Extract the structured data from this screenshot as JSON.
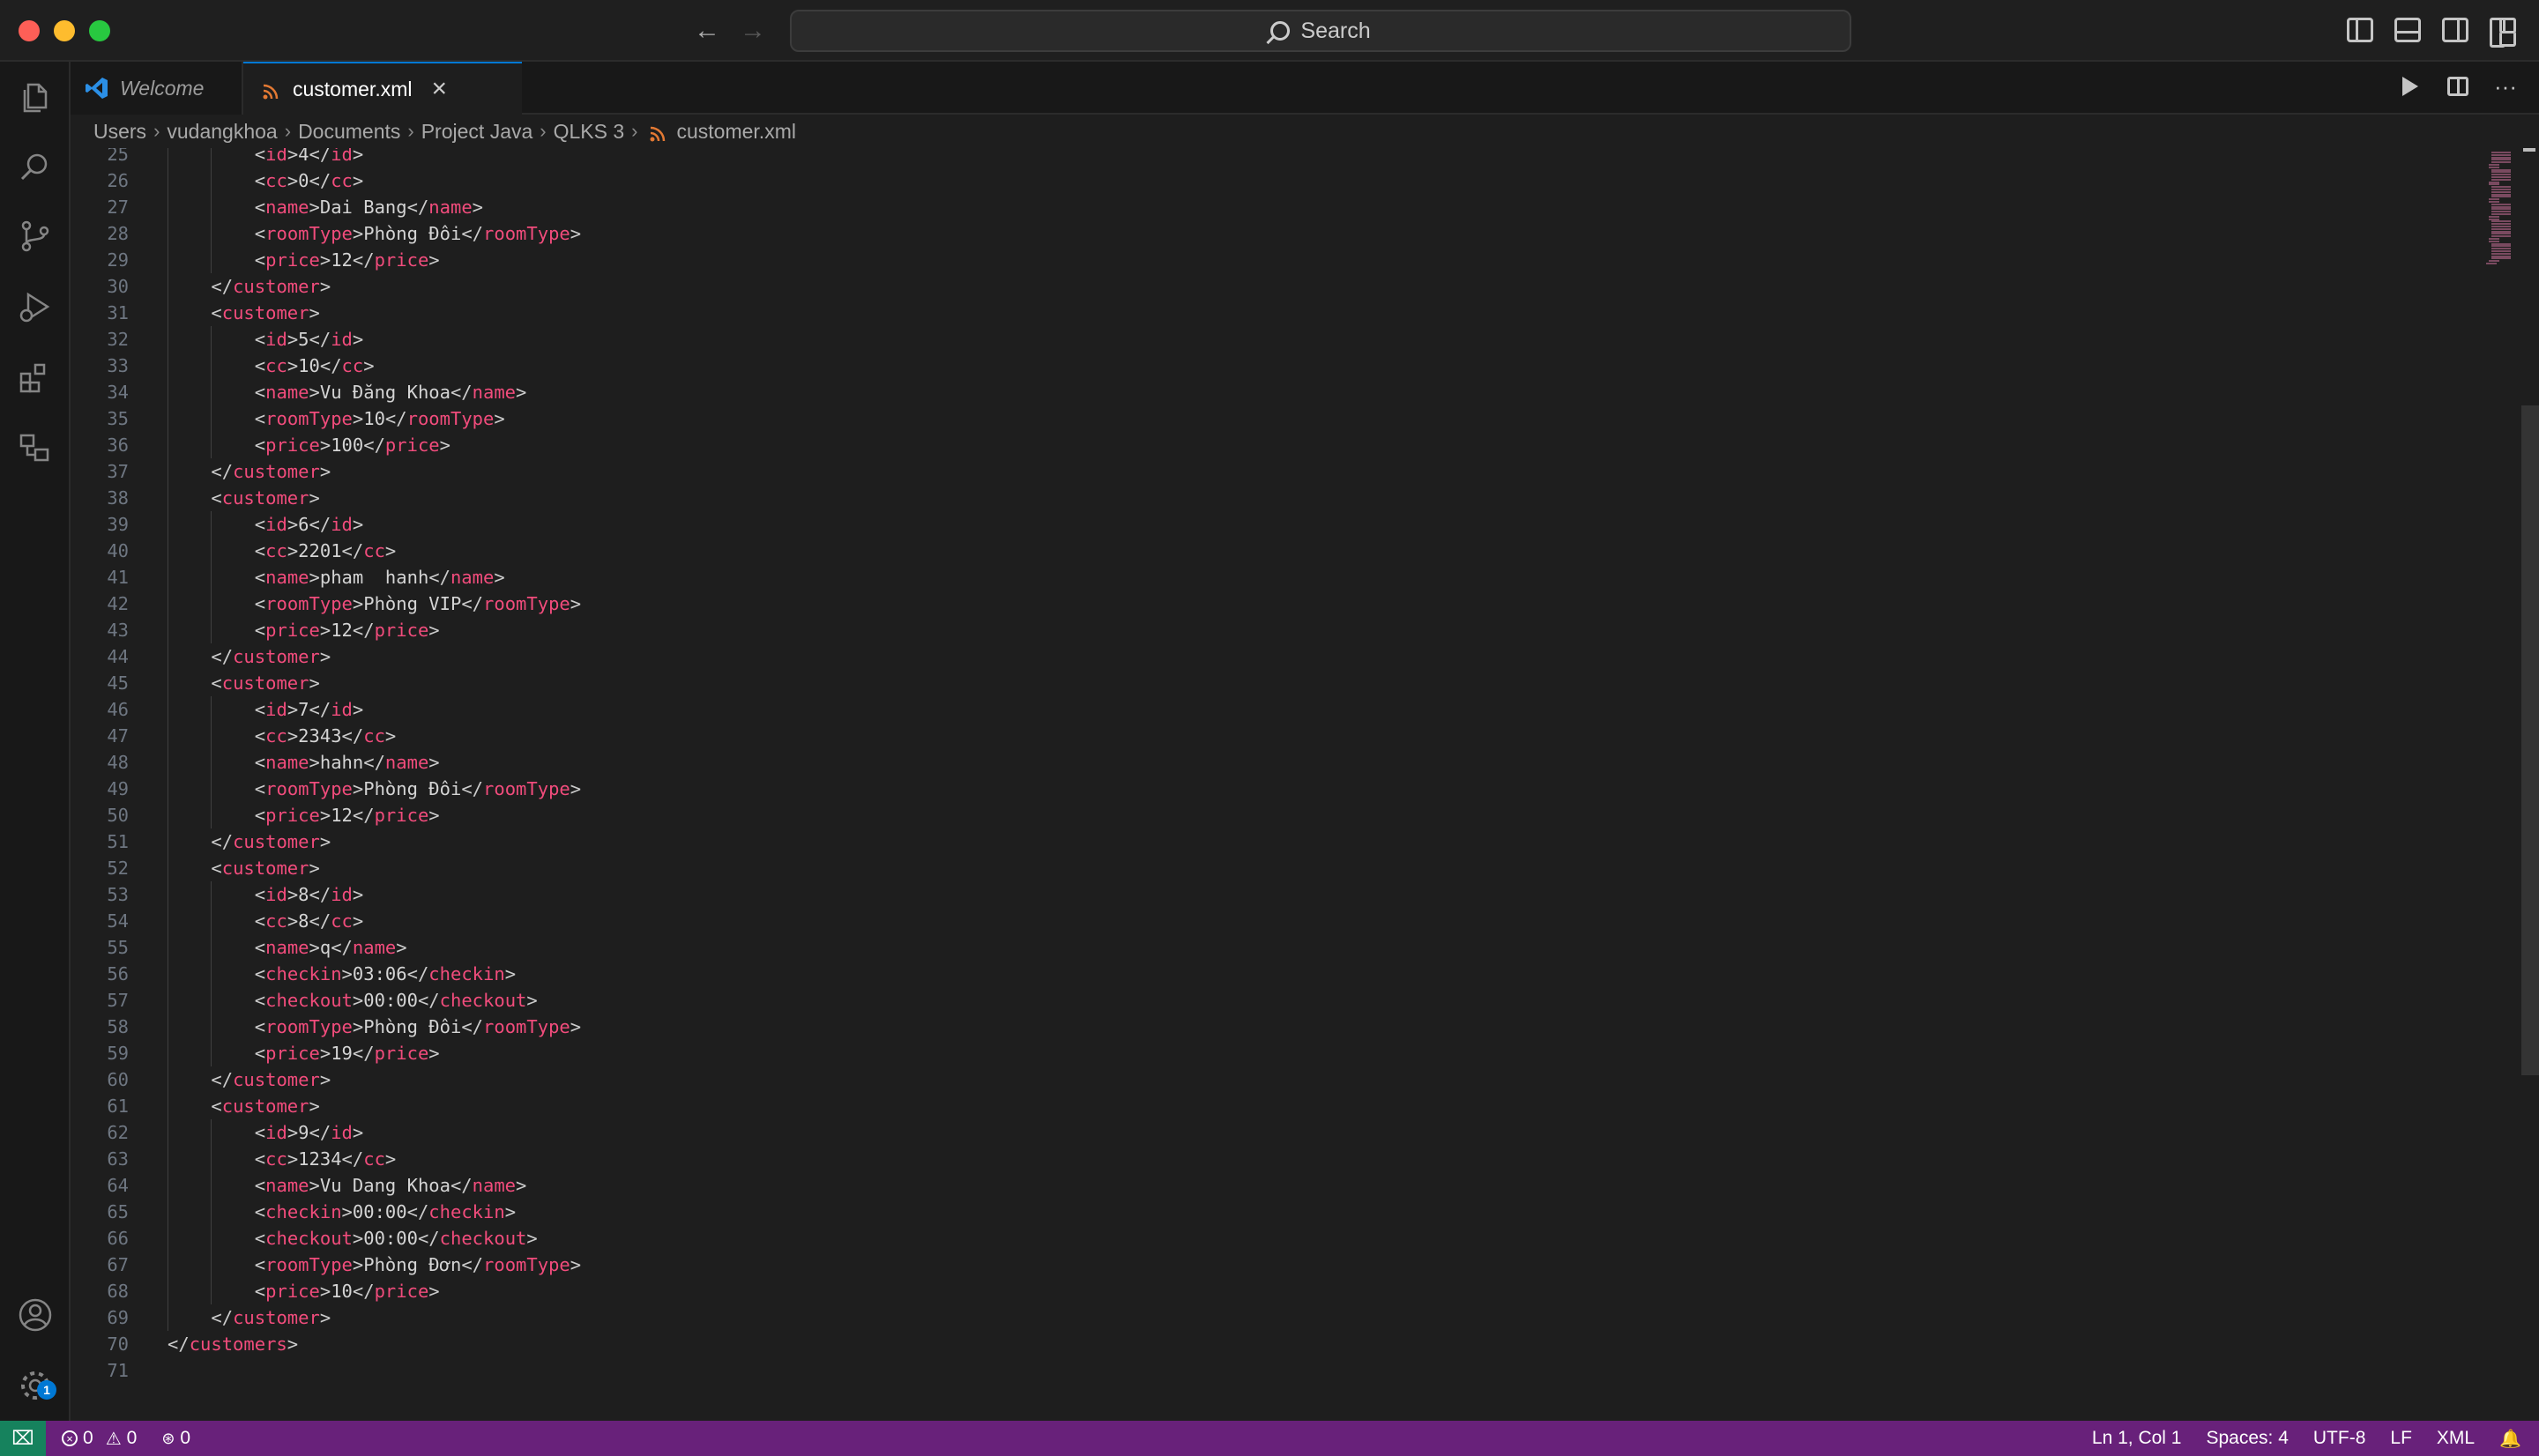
{
  "titlebar": {
    "search_label": "Search"
  },
  "tabs": [
    {
      "label": "Welcome"
    },
    {
      "label": "customer.xml"
    }
  ],
  "breadcrumb": [
    "Users",
    "vudangkhoa",
    "Documents",
    "Project Java",
    "QLKS 3",
    "customer.xml"
  ],
  "editor": {
    "lines": [
      {
        "n": "25",
        "indent": 2,
        "tag": "id",
        "value": "4"
      },
      {
        "n": "26",
        "indent": 2,
        "tag": "cc",
        "value": "0"
      },
      {
        "n": "27",
        "indent": 2,
        "tag": "name",
        "value": "Dai Bang"
      },
      {
        "n": "28",
        "indent": 2,
        "tag": "roomType",
        "value": "Phòng Đôi"
      },
      {
        "n": "29",
        "indent": 2,
        "tag": "price",
        "value": "12"
      },
      {
        "n": "30",
        "indent": 1,
        "close": "customer"
      },
      {
        "n": "31",
        "indent": 1,
        "open": "customer"
      },
      {
        "n": "32",
        "indent": 2,
        "tag": "id",
        "value": "5"
      },
      {
        "n": "33",
        "indent": 2,
        "tag": "cc",
        "value": "10"
      },
      {
        "n": "34",
        "indent": 2,
        "tag": "name",
        "value": "Vu Đăng Khoa"
      },
      {
        "n": "35",
        "indent": 2,
        "tag": "roomType",
        "value": "10"
      },
      {
        "n": "36",
        "indent": 2,
        "tag": "price",
        "value": "100"
      },
      {
        "n": "37",
        "indent": 1,
        "close": "customer"
      },
      {
        "n": "38",
        "indent": 1,
        "open": "customer"
      },
      {
        "n": "39",
        "indent": 2,
        "tag": "id",
        "value": "6"
      },
      {
        "n": "40",
        "indent": 2,
        "tag": "cc",
        "value": "2201"
      },
      {
        "n": "41",
        "indent": 2,
        "tag": "name",
        "value": "pham  hanh"
      },
      {
        "n": "42",
        "indent": 2,
        "tag": "roomType",
        "value": "Phòng VIP"
      },
      {
        "n": "43",
        "indent": 2,
        "tag": "price",
        "value": "12"
      },
      {
        "n": "44",
        "indent": 1,
        "close": "customer"
      },
      {
        "n": "45",
        "indent": 1,
        "open": "customer"
      },
      {
        "n": "46",
        "indent": 2,
        "tag": "id",
        "value": "7"
      },
      {
        "n": "47",
        "indent": 2,
        "tag": "cc",
        "value": "2343"
      },
      {
        "n": "48",
        "indent": 2,
        "tag": "name",
        "value": "hahn"
      },
      {
        "n": "49",
        "indent": 2,
        "tag": "roomType",
        "value": "Phòng Đôi"
      },
      {
        "n": "50",
        "indent": 2,
        "tag": "price",
        "value": "12"
      },
      {
        "n": "51",
        "indent": 1,
        "close": "customer"
      },
      {
        "n": "52",
        "indent": 1,
        "open": "customer"
      },
      {
        "n": "53",
        "indent": 2,
        "tag": "id",
        "value": "8"
      },
      {
        "n": "54",
        "indent": 2,
        "tag": "cc",
        "value": "8"
      },
      {
        "n": "55",
        "indent": 2,
        "tag": "name",
        "value": "q"
      },
      {
        "n": "56",
        "indent": 2,
        "tag": "checkin",
        "value": "03:06"
      },
      {
        "n": "57",
        "indent": 2,
        "tag": "checkout",
        "value": "00:00"
      },
      {
        "n": "58",
        "indent": 2,
        "tag": "roomType",
        "value": "Phòng Đôi"
      },
      {
        "n": "59",
        "indent": 2,
        "tag": "price",
        "value": "19"
      },
      {
        "n": "60",
        "indent": 1,
        "close": "customer"
      },
      {
        "n": "61",
        "indent": 1,
        "open": "customer"
      },
      {
        "n": "62",
        "indent": 2,
        "tag": "id",
        "value": "9"
      },
      {
        "n": "63",
        "indent": 2,
        "tag": "cc",
        "value": "1234"
      },
      {
        "n": "64",
        "indent": 2,
        "tag": "name",
        "value": "Vu Dang Khoa"
      },
      {
        "n": "65",
        "indent": 2,
        "tag": "checkin",
        "value": "00:00"
      },
      {
        "n": "66",
        "indent": 2,
        "tag": "checkout",
        "value": "00:00"
      },
      {
        "n": "67",
        "indent": 2,
        "tag": "roomType",
        "value": "Phòng Đơn"
      },
      {
        "n": "68",
        "indent": 2,
        "tag": "price",
        "value": "10"
      },
      {
        "n": "69",
        "indent": 1,
        "close": "customer"
      },
      {
        "n": "70",
        "indent": 0,
        "close": "customers"
      },
      {
        "n": "71",
        "indent": 0
      }
    ]
  },
  "statusbar": {
    "errors": "0",
    "warnings": "0",
    "ports": "0",
    "position": "Ln 1, Col 1",
    "spaces": "Spaces: 4",
    "encoding": "UTF-8",
    "eol": "LF",
    "language": "XML"
  },
  "activity": {
    "settings_badge": "1"
  },
  "colors": {
    "accent": "#0078d4",
    "statusbar": "#68217a",
    "tag": "#f14c7c"
  }
}
